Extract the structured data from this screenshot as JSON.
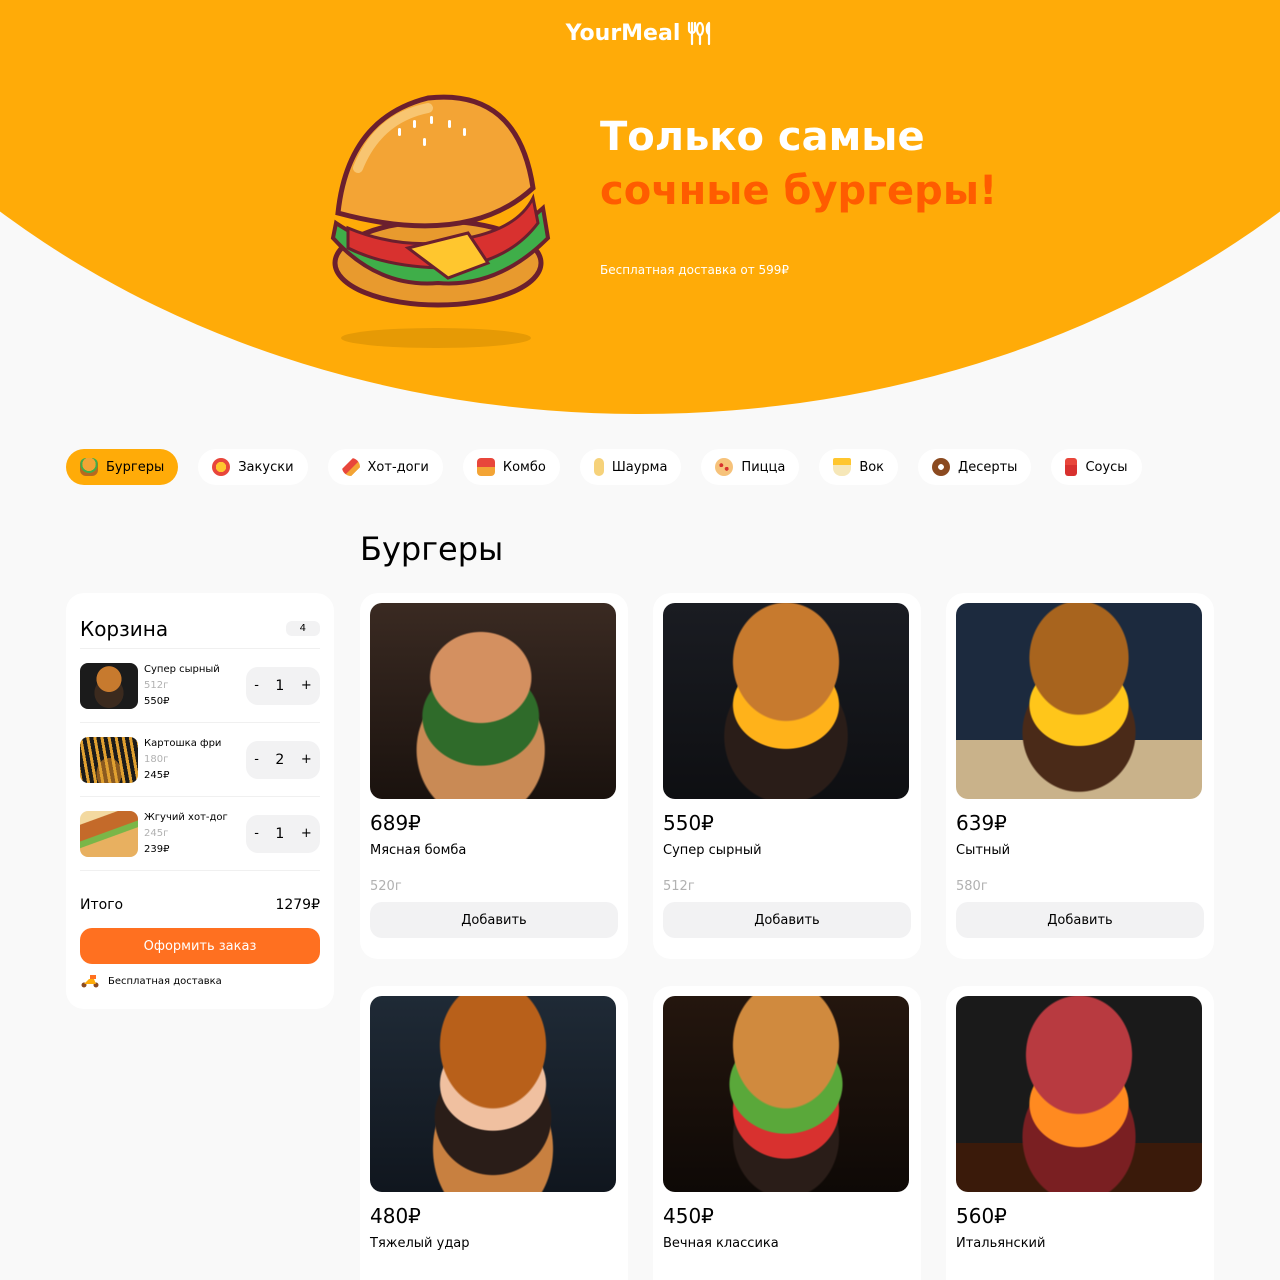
{
  "header": {
    "logo": "YourMeal",
    "title_line1": "Только самые",
    "title_line2": "сочные бургеры!",
    "subtitle": "Бесплатная доставка от 599₽"
  },
  "categories": [
    {
      "label": "Бургеры",
      "icon": "burger-icon",
      "active": true
    },
    {
      "label": "Закуски",
      "icon": "snacks-icon",
      "active": false
    },
    {
      "label": "Хот-доги",
      "icon": "hotdog-icon",
      "active": false
    },
    {
      "label": "Комбо",
      "icon": "combo-icon",
      "active": false
    },
    {
      "label": "Шаурма",
      "icon": "shawarma-icon",
      "active": false
    },
    {
      "label": "Пицца",
      "icon": "pizza-icon",
      "active": false
    },
    {
      "label": "Вок",
      "icon": "wok-icon",
      "active": false
    },
    {
      "label": "Десерты",
      "icon": "donut-icon",
      "active": false
    },
    {
      "label": "Соусы",
      "icon": "sauce-icon",
      "active": false
    }
  ],
  "section_title": "Бургеры",
  "cart": {
    "title": "Корзина",
    "count": "4",
    "items": [
      {
        "name": "Супер сырный",
        "weight": "512г",
        "price": "550₽",
        "qty": "1"
      },
      {
        "name": "Картошка фри",
        "weight": "180г",
        "price": "245₽",
        "qty": "2"
      },
      {
        "name": "Жгучий хот-дог",
        "weight": "245г",
        "price": "239₽",
        "qty": "1"
      }
    ],
    "total_label": "Итого",
    "total_value": "1279₽",
    "order_button": "Оформить заказ",
    "delivery_text": "Бесплатная доставка",
    "minus": "-",
    "plus": "+"
  },
  "products": [
    {
      "price": "689₽",
      "name": "Мясная бомба",
      "weight": "520г",
      "button": "Добавить"
    },
    {
      "price": "550₽",
      "name": "Супер сырный",
      "weight": "512г",
      "button": "Добавить"
    },
    {
      "price": "639₽",
      "name": "Сытный",
      "weight": "580г",
      "button": "Добавить"
    },
    {
      "price": "480₽",
      "name": "Тяжелый удар",
      "weight": "",
      "button": ""
    },
    {
      "price": "450₽",
      "name": "Вечная классика",
      "weight": "",
      "button": ""
    },
    {
      "price": "560₽",
      "name": "Итальянский",
      "weight": "",
      "button": ""
    }
  ],
  "colors": {
    "accent": "#ffab08",
    "orange": "#ff5c00",
    "order_button": "#ff7020",
    "background": "#f9f9f9"
  }
}
